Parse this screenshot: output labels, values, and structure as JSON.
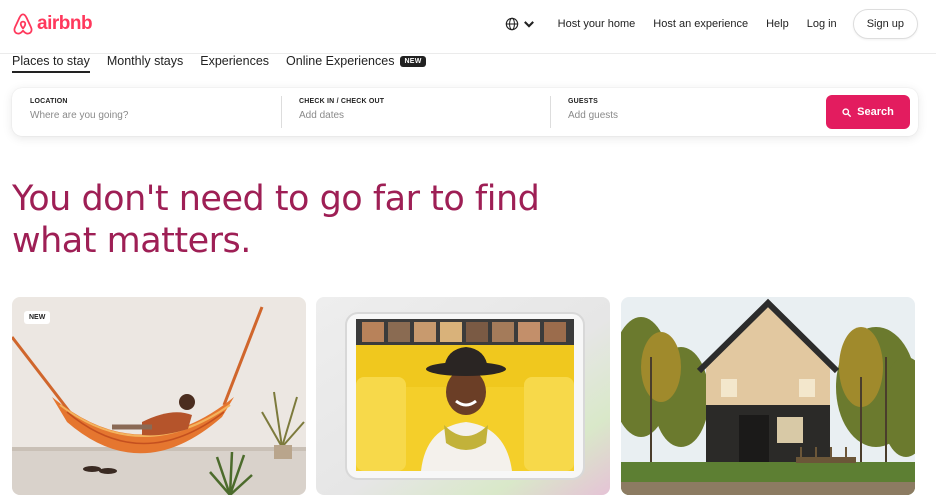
{
  "header": {
    "logo_text": "airbnb",
    "brand_color": "#FF385C",
    "globe_icon": "globe-icon",
    "links": [
      "Host your home",
      "Host an experience",
      "Help",
      "Log in"
    ],
    "signup_label": "Sign up"
  },
  "tabs": {
    "items": [
      "Places to stay",
      "Monthly stays",
      "Experiences"
    ],
    "online_label": "Online Experiences",
    "online_badge": "NEW",
    "active_index": 0
  },
  "search": {
    "location": {
      "label": "LOCATION",
      "placeholder": "Where are you going?"
    },
    "dates": {
      "label": "CHECK IN / CHECK OUT",
      "placeholder": "Add dates"
    },
    "guests": {
      "label": "GUESTS",
      "placeholder": "Add guests"
    },
    "button_label": "Search",
    "button_color": "#E31C5F"
  },
  "hero": {
    "line1": "You don't need to go far to find",
    "line2": "what matters.",
    "color": "#9E1F55"
  },
  "cards": [
    {
      "name": "hammock-card",
      "badge": "NEW",
      "image": "person-in-hammock"
    },
    {
      "name": "online-experience-card",
      "image": "video-call-tablet"
    },
    {
      "name": "cabin-card",
      "image": "modern-cabin-in-woods"
    }
  ]
}
